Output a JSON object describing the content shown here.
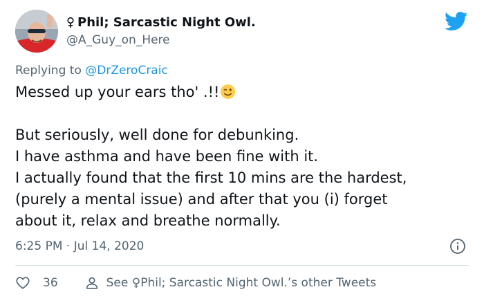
{
  "author": {
    "name": "Phil; Sarcastic Night Owl.",
    "handle": "@A_Guy_on_Here"
  },
  "reply": {
    "prefix": "Replying to ",
    "mention": "@DrZeroCraic"
  },
  "tweet": {
    "line1": "Messed up your ears tho' .!!",
    "line2": "But seriously, well done for debunking.",
    "line3": "I have asthma and have been fine with it.",
    "line4": "I actually found that the first 10 mins are the hardest,",
    "line5": "(purely a mental issue) and after that you (i) forget",
    "line6": "about it, relax and breathe normally."
  },
  "meta": {
    "timestamp": "6:25 PM · Jul 14, 2020"
  },
  "actions": {
    "like_count": "36",
    "see_other": "See ♀Phil; Sarcastic Night Owl.’s other Tweets"
  },
  "icons": {
    "brand": "twitter-bird-icon",
    "like": "heart-icon",
    "profile": "person-icon",
    "info": "info-icon",
    "emoji": "winking-face-emoji"
  },
  "colors": {
    "brand_blue": "#1da1f2",
    "link_blue": "#1b95e0",
    "secondary_text": "#536471",
    "divider": "#cfd9de"
  }
}
